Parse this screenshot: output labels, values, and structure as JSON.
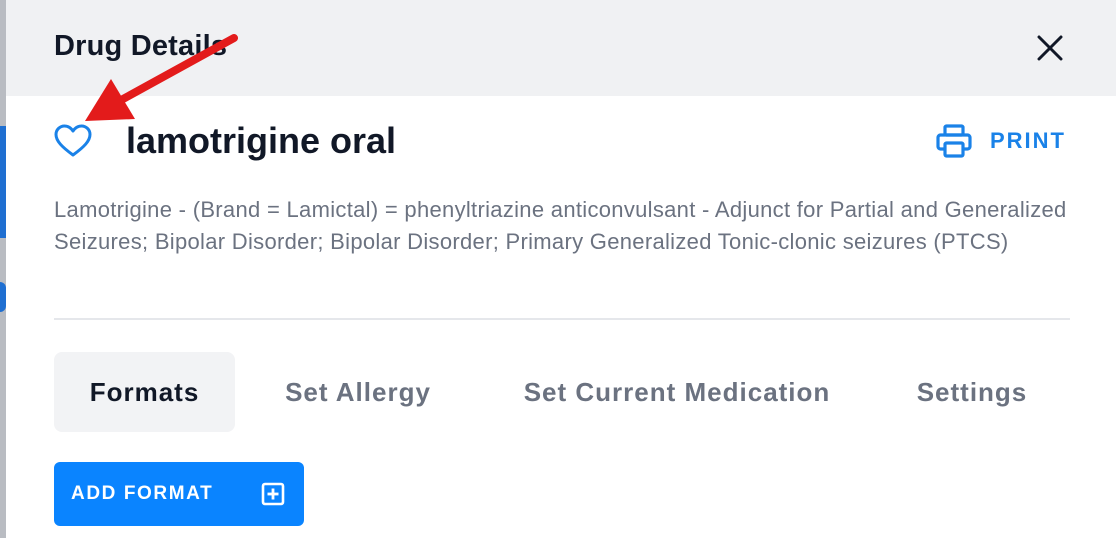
{
  "modal": {
    "title": "Drug Details",
    "close_icon": "close-icon"
  },
  "drug": {
    "name": "lamotrigine oral",
    "favorite_icon": "heart-outline-icon",
    "description": "Lamotrigine - (Brand = Lamictal) = phenyltriazine anticonvulsant - Adjunct for Partial and Generalized Seizures; Bipolar Disorder; Bipolar Disorder; Primary Generalized Tonic-clonic seizures (PTCS)"
  },
  "print": {
    "label": "PRINT",
    "icon": "printer-icon"
  },
  "tabs": [
    {
      "label": "Formats",
      "active": true
    },
    {
      "label": "Set Allergy",
      "active": false
    },
    {
      "label": "Set Current Medication",
      "active": false
    },
    {
      "label": "Settings",
      "active": false
    }
  ],
  "add_format": {
    "label": "ADD FORMAT",
    "icon": "plus-square-icon"
  },
  "annotation": {
    "icon": "red-arrow-icon"
  },
  "colors": {
    "accent_blue": "#1a82e8",
    "button_blue": "#0a84ff",
    "header_bg": "#f0f1f3",
    "annotation_red": "#e31b1b"
  }
}
